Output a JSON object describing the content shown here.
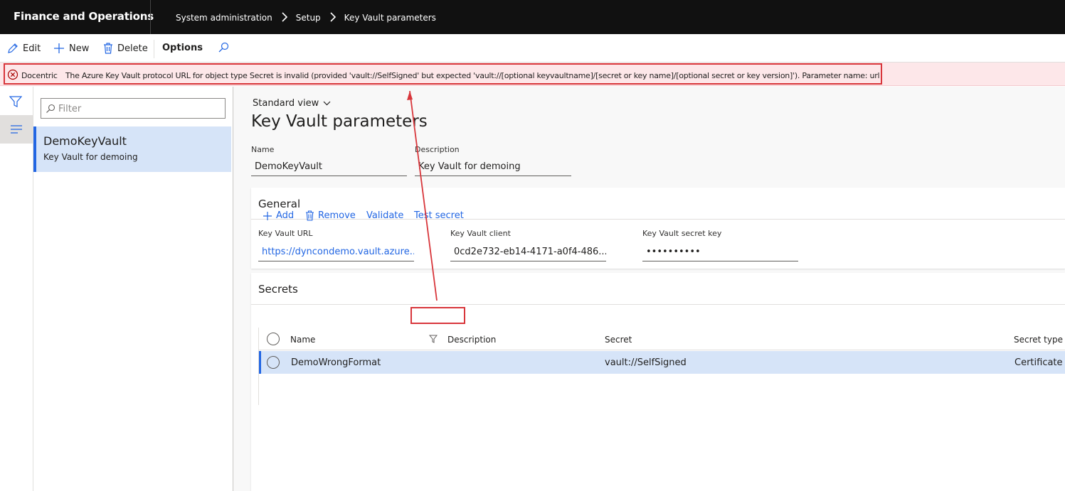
{
  "app": {
    "title": "Finance and Operations"
  },
  "breadcrumb": [
    "System administration",
    "Setup",
    "Key Vault parameters"
  ],
  "actions": {
    "edit": "Edit",
    "new": "New",
    "delete": "Delete",
    "options": "Options"
  },
  "message": {
    "source": "Docentric",
    "text": "The Azure Key Vault protocol URL for object type Secret is invalid (provided 'vault://SelfSigned' but expected 'vault://[optional keyvaultname]/[secret or key name]/[optional secret or key version]'). Parameter name: url"
  },
  "list": {
    "filter_placeholder": "Filter",
    "items": [
      {
        "title": "DemoKeyVault",
        "subtitle": "Key Vault for demoing"
      }
    ]
  },
  "view": {
    "label": "Standard view"
  },
  "page": {
    "title": "Key Vault parameters"
  },
  "header_fields": {
    "name_label": "Name",
    "name_value": "DemoKeyVault",
    "description_label": "Description",
    "description_value": "Key Vault for demoing"
  },
  "general": {
    "title": "General",
    "url_label": "Key Vault URL",
    "url_value": "https://dyncondemo.vault.azure...",
    "client_label": "Key Vault client",
    "client_value": "0cd2e732-eb14-4171-a0f4-486...",
    "secret_key_label": "Key Vault secret key",
    "secret_key_value": "••••••••••"
  },
  "secrets": {
    "title": "Secrets",
    "toolbar": {
      "add": "Add",
      "remove": "Remove",
      "validate": "Validate",
      "test_secret": "Test secret"
    },
    "columns": {
      "name": "Name",
      "description": "Description",
      "secret": "Secret",
      "secret_type": "Secret type"
    },
    "rows": [
      {
        "name": "DemoWrongFormat",
        "description": "",
        "secret": "vault://SelfSigned",
        "secret_type": "Certificate"
      }
    ]
  },
  "colors": {
    "accent": "#2266e3",
    "error": "#d8363b",
    "error_bg": "#fde7e9",
    "selection": "#d6e4f8"
  }
}
